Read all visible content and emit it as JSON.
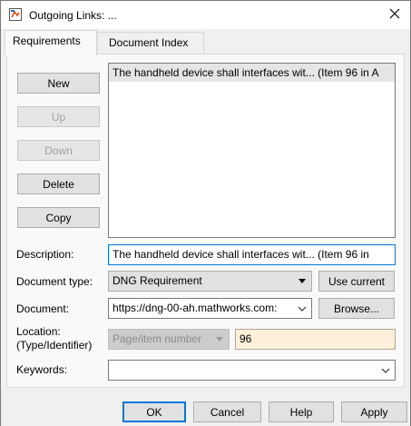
{
  "window": {
    "title": "Outgoing Links: ..."
  },
  "tabs": [
    {
      "label": "Requirements",
      "active": true
    },
    {
      "label": "Document Index",
      "active": false
    }
  ],
  "side_buttons": {
    "new": "New",
    "up": "Up",
    "down": "Down",
    "delete": "Delete",
    "copy": "Copy"
  },
  "links_list": {
    "items": [
      "The handheld device shall interfaces wit... (Item 96 in A"
    ]
  },
  "form": {
    "description_label": "Description:",
    "description_value": "The handheld device shall interfaces wit... (Item 96 in",
    "doc_type_label": "Document type:",
    "doc_type_value": "DNG Requirement",
    "use_current": "Use current",
    "document_label": "Document:",
    "document_value": "https://dng-00-ah.mathworks.com:",
    "browse": "Browse...",
    "location_label_1": "Location:",
    "location_label_2": "(Type/Identifier)",
    "location_type": "Page/item number",
    "location_id": "96",
    "keywords_label": "Keywords:",
    "keywords_value": ""
  },
  "footer": {
    "ok": "OK",
    "cancel": "Cancel",
    "help": "Help",
    "apply": "Apply"
  }
}
